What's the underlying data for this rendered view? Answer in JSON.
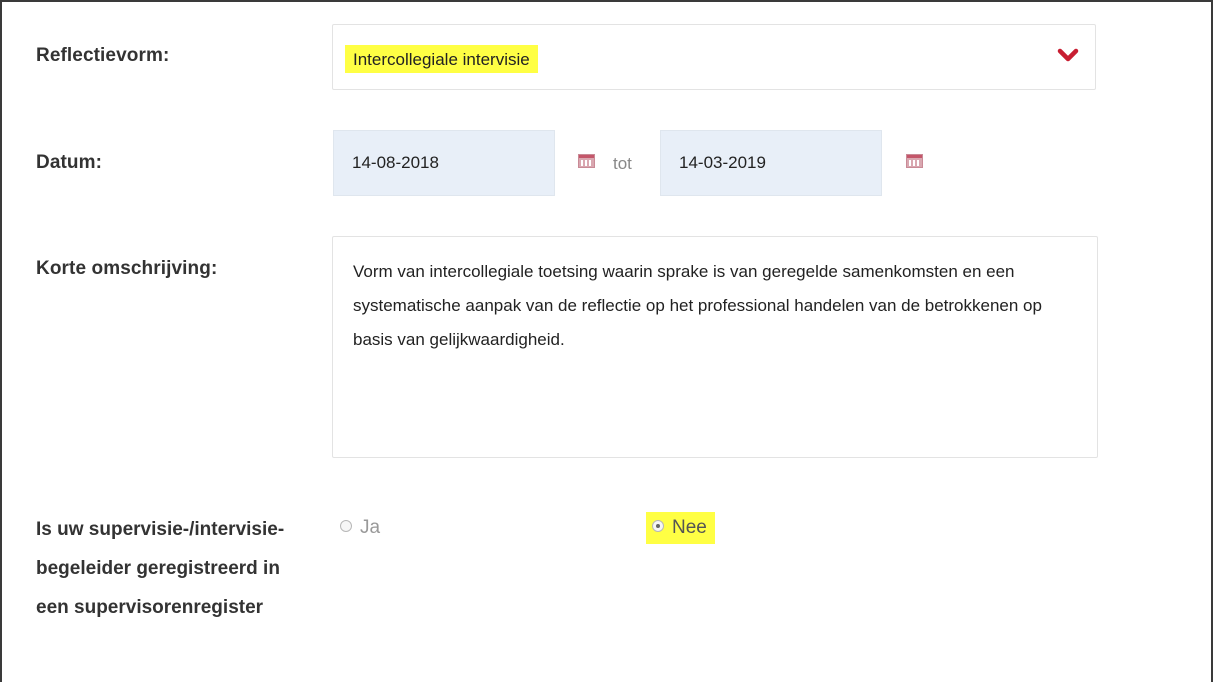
{
  "form": {
    "reflectievorm": {
      "label": "Reflectievorm:",
      "value": "Intercollegiale intervisie",
      "icon": "chevron-down-icon",
      "accent": "#c81e32"
    },
    "datum": {
      "label": "Datum:",
      "from": "14-08-2018",
      "to_label": "tot",
      "to": "14-03-2019",
      "icon": "calendar-icon"
    },
    "omschrijving": {
      "label": "Korte omschrijving:",
      "value": "Vorm van intercollegiale toetsing waarin sprake is van geregelde samenkomsten en een systematische aanpak van de reflectie op het professional handelen van de betrokkenen op basis van gelijkwaardigheid."
    },
    "register": {
      "question": "Is uw supervisie-/intervisie-begeleider geregistreerd in een supervisorenregister",
      "options": [
        "Ja",
        "Nee"
      ],
      "selected": "Nee"
    }
  },
  "highlight_color": "#ffff44"
}
